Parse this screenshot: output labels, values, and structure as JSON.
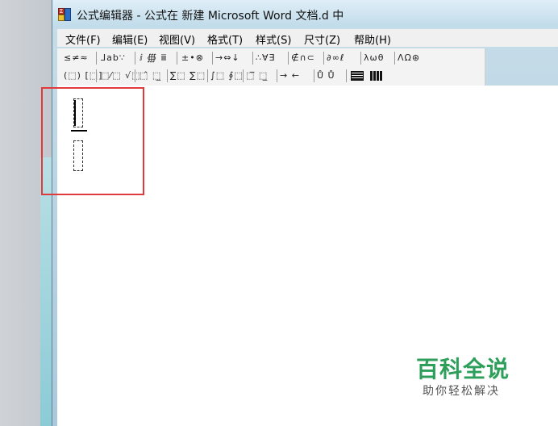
{
  "window": {
    "title": "公式编辑器 - 公式在 新建 Microsoft Word 文档.d 中",
    "icon_text": "Σ"
  },
  "menu": [
    {
      "label": "文件(F)"
    },
    {
      "label": "编辑(E)"
    },
    {
      "label": "视图(V)"
    },
    {
      "label": "格式(T)"
    },
    {
      "label": "样式(S)"
    },
    {
      "label": "尺寸(Z)"
    },
    {
      "label": "帮助(H)"
    }
  ],
  "toolbar": {
    "row1": [
      "≤≠≈",
      "⅃ab∵",
      "ⅈ ∰ ⅲ",
      "±•⊗",
      "→⇔↓",
      "∴∀∃",
      "∉∩⊂",
      "∂∞ℓ",
      "λωθ",
      "ΛΩ⊛"
    ],
    "row2": [
      "(⬚) [⬚]",
      "⬚⁄⬚ √⬚",
      "⬚̂ ⬚̲",
      "∑⬚ ∑⬚",
      "∫⬚ ∮⬚",
      "⬚̅ ⬚̲",
      "→ ←",
      "Ů Ů",
      "▪▪▪",
      "▦"
    ]
  },
  "watermark": {
    "title": "百科全说",
    "subtitle": "助你轻松解决"
  },
  "colors": {
    "highlight": "#e03a3a",
    "watermark": "#2e9e5b"
  }
}
